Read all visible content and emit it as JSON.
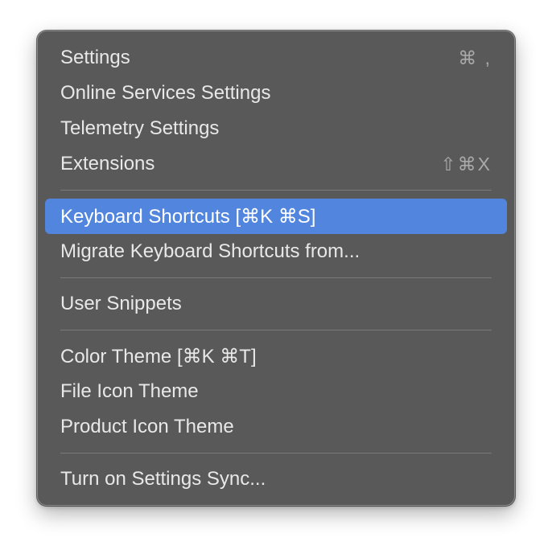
{
  "menu": {
    "groups": [
      {
        "items": [
          {
            "label": "Settings",
            "shortcut": "⌘ ,"
          },
          {
            "label": "Online Services Settings",
            "shortcut": ""
          },
          {
            "label": "Telemetry Settings",
            "shortcut": ""
          },
          {
            "label": "Extensions",
            "shortcut": "⇧⌘X"
          }
        ]
      },
      {
        "items": [
          {
            "label": "Keyboard Shortcuts [⌘K ⌘S]",
            "shortcut": "",
            "highlighted": true
          },
          {
            "label": "Migrate Keyboard Shortcuts from...",
            "shortcut": ""
          }
        ]
      },
      {
        "items": [
          {
            "label": "User Snippets",
            "shortcut": ""
          }
        ]
      },
      {
        "items": [
          {
            "label": "Color Theme [⌘K ⌘T]",
            "shortcut": ""
          },
          {
            "label": "File Icon Theme",
            "shortcut": ""
          },
          {
            "label": "Product Icon Theme",
            "shortcut": ""
          }
        ]
      },
      {
        "items": [
          {
            "label": "Turn on Settings Sync...",
            "shortcut": ""
          }
        ]
      }
    ]
  },
  "colors": {
    "menu_background": "#595959",
    "highlight": "#5286de",
    "text": "#e8e8e8",
    "shortcut_text": "#a9a9a9"
  }
}
